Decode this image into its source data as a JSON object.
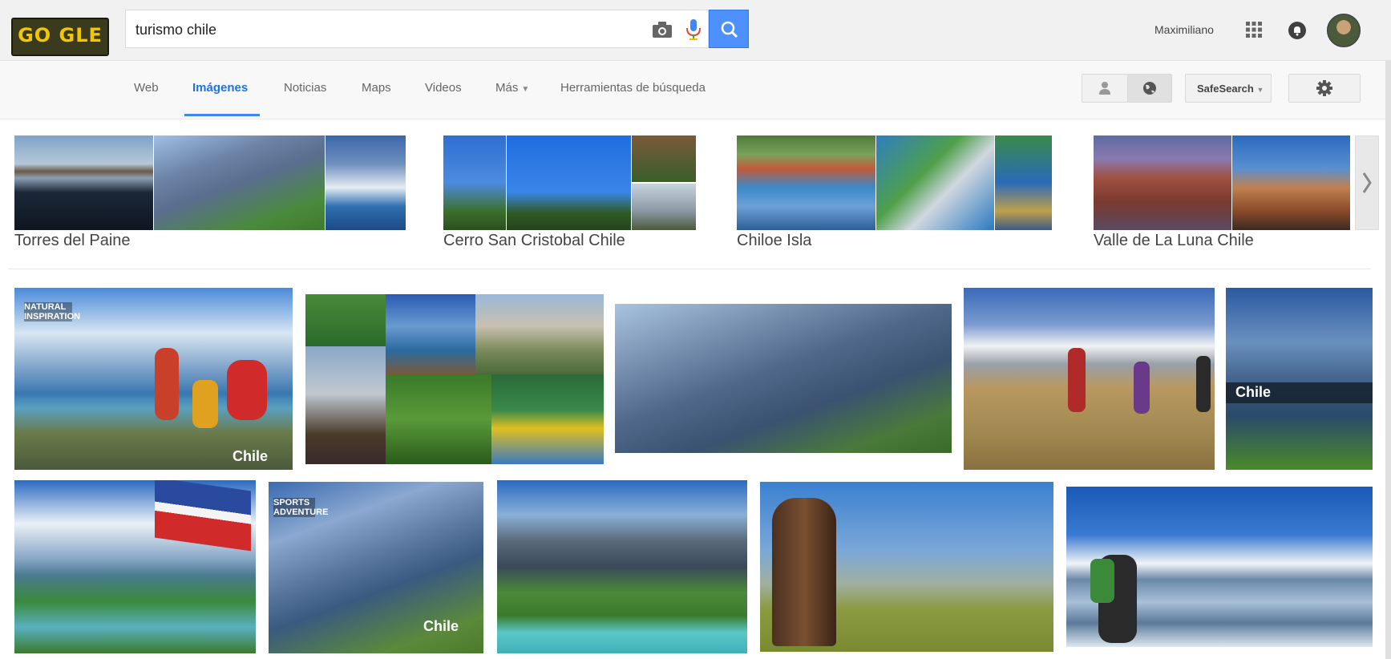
{
  "logo": {
    "text": "GO  GLE"
  },
  "search": {
    "value": "turismo chile",
    "placeholder": ""
  },
  "header": {
    "user_name": "Maximiliano"
  },
  "nav": {
    "tabs": [
      {
        "label": "Web"
      },
      {
        "label": "Imágenes"
      },
      {
        "label": "Noticias"
      },
      {
        "label": "Maps"
      },
      {
        "label": "Videos"
      },
      {
        "label": "Más"
      },
      {
        "label": "Herramientas de búsqueda"
      }
    ],
    "safesearch_label": "SafeSearch"
  },
  "clusters": [
    {
      "label": "Torres del Paine"
    },
    {
      "label": "Cerro San Cristobal Chile"
    },
    {
      "label": "Chiloe Isla"
    },
    {
      "label": "Valle de La Luna Chile"
    }
  ],
  "overlays": {
    "natural_inspiration": "NATURAL INSPIRATION",
    "chile": "Chile",
    "chile_banner": "Chile",
    "sports_adventure": "SPORTS ADVENTURE",
    "chile2": "Chile"
  },
  "icons": [
    "camera-icon",
    "microphone-icon",
    "search-icon",
    "apps-grid-icon",
    "notifications-icon",
    "person-icon",
    "globe-icon",
    "gear-icon",
    "chevron-right-icon",
    "chevron-down-icon"
  ],
  "colors": {
    "accent": "#4285f4",
    "search_button": "#4d90fe",
    "active_tab": "#1a73e8"
  }
}
